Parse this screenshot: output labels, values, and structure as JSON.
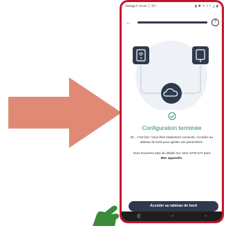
{
  "statusbar": {
    "left": "Orange F 11:42 ⓘ ▦ •",
    "right": "▮ ✱ ✎ ⟟ ▿ ◿ ▮"
  },
  "topbar": {
    "back_icon": "arrow-left-icon",
    "help_label": "?",
    "progress_fraction": 1.0
  },
  "illustration": {
    "icons": [
      "router-icon",
      "device-icon",
      "cloud-icon"
    ]
  },
  "status_icon": "check-circle-icon",
  "title": "Configuration terminée",
  "text_intro": "Et... c'est fait ! Vous êtes totalement connecté. Accédez au tableau de bord pour ajuster vos paramètres.",
  "text_more_prefix": "Vous trouverez plus de détails sur votre GTW IOT dans",
  "text_more_link": "Mes appareils",
  "text_more_suffix": ".",
  "cta_label": "Accéder au tableau de bord",
  "navbar": {
    "recent": "|||",
    "home": "○",
    "back": "‹"
  },
  "colors": {
    "arrow": "#e08a76",
    "frame": "#c2132a",
    "accent": "#2a8a6a",
    "dark": "#2d3a4e",
    "pointer": "#3a8a3a"
  }
}
